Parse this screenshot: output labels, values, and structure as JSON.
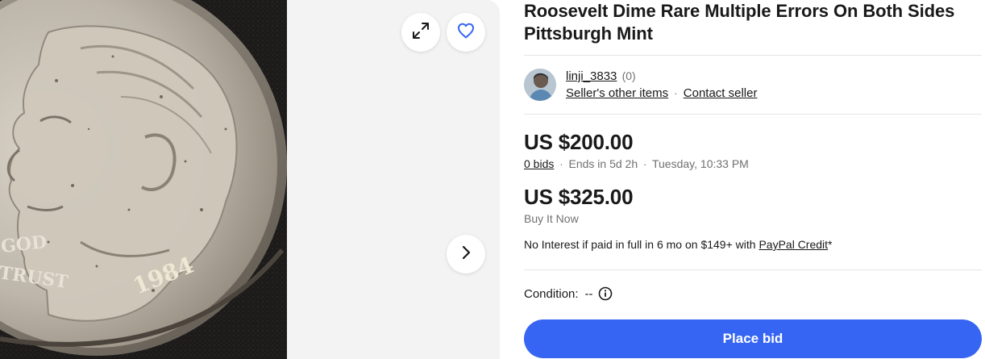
{
  "listing": {
    "title": "Roosevelt Dime Rare Multiple Errors On Both Sides Pittsburgh Mint"
  },
  "gallery": {
    "image_alt": "Roosevelt dime close-up photo",
    "coin_text": {
      "legend_god": "GOD",
      "legend_trust": "TRUST",
      "year": "1984"
    },
    "icons": {
      "expand": "expand-icon",
      "watch": "heart-icon",
      "next": "chevron-right-icon"
    }
  },
  "seller": {
    "name": "linji_3833",
    "score": "(0)",
    "other_items": "Seller's other items",
    "separator": "·",
    "contact": "Contact seller"
  },
  "bid": {
    "price": "US $200.00",
    "bids": "0 bids",
    "separator": "·",
    "ends": "Ends in 5d 2h",
    "ends_date": "Tuesday, 10:33 PM"
  },
  "buy_now": {
    "price": "US $325.00",
    "label": "Buy It Now"
  },
  "financing": {
    "text": "No Interest if paid in full in 6 mo on $149+ with",
    "link": "PayPal Credit",
    "asterisk": "*"
  },
  "condition": {
    "label": "Condition:",
    "value": "--"
  },
  "actions": {
    "place_bid": "Place bid"
  },
  "colors": {
    "primary": "#3665f3",
    "text": "#191919",
    "secondary_text": "#707070",
    "divider": "#e5e5e5"
  }
}
